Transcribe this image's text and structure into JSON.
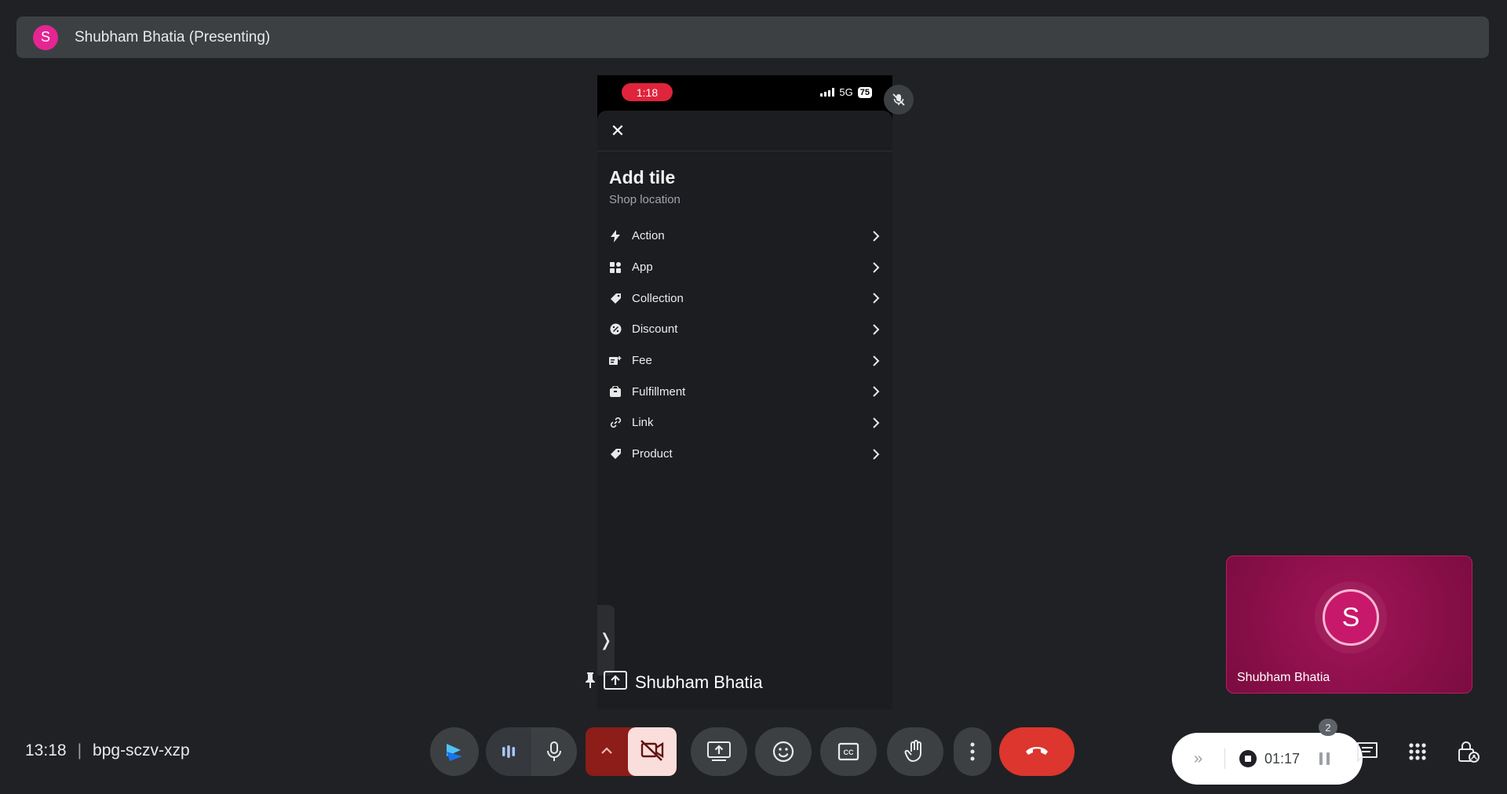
{
  "banner": {
    "avatar_letter": "S",
    "title": "Shubham Bhatia (Presenting)"
  },
  "phone": {
    "status_time": "1:18",
    "network": "5G",
    "battery": "75",
    "sheet": {
      "title": "Add tile",
      "subtitle": "Shop location",
      "items": [
        {
          "label": "Action",
          "icon": "bolt-icon"
        },
        {
          "label": "App",
          "icon": "apps-icon"
        },
        {
          "label": "Collection",
          "icon": "tag-icon"
        },
        {
          "label": "Discount",
          "icon": "discount-icon"
        },
        {
          "label": "Fee",
          "icon": "fee-icon"
        },
        {
          "label": "Fulfillment",
          "icon": "box-icon"
        },
        {
          "label": "Link",
          "icon": "link-icon"
        },
        {
          "label": "Product",
          "icon": "product-tag-icon"
        }
      ]
    }
  },
  "presenter": {
    "name": "Shubham Bhatia"
  },
  "self_tile": {
    "avatar_letter": "S",
    "name": "Shubham Bhatia"
  },
  "meeting": {
    "time": "13:18",
    "code": "bpg-sczv-xzp"
  },
  "recorder": {
    "elapsed": "01:17"
  },
  "people_count": "2",
  "colors": {
    "end_call": "#dc362e",
    "camera_off_bg": "#f9dedc",
    "avatar_pink": "#e52592",
    "rec_pill": "#e0243b"
  }
}
